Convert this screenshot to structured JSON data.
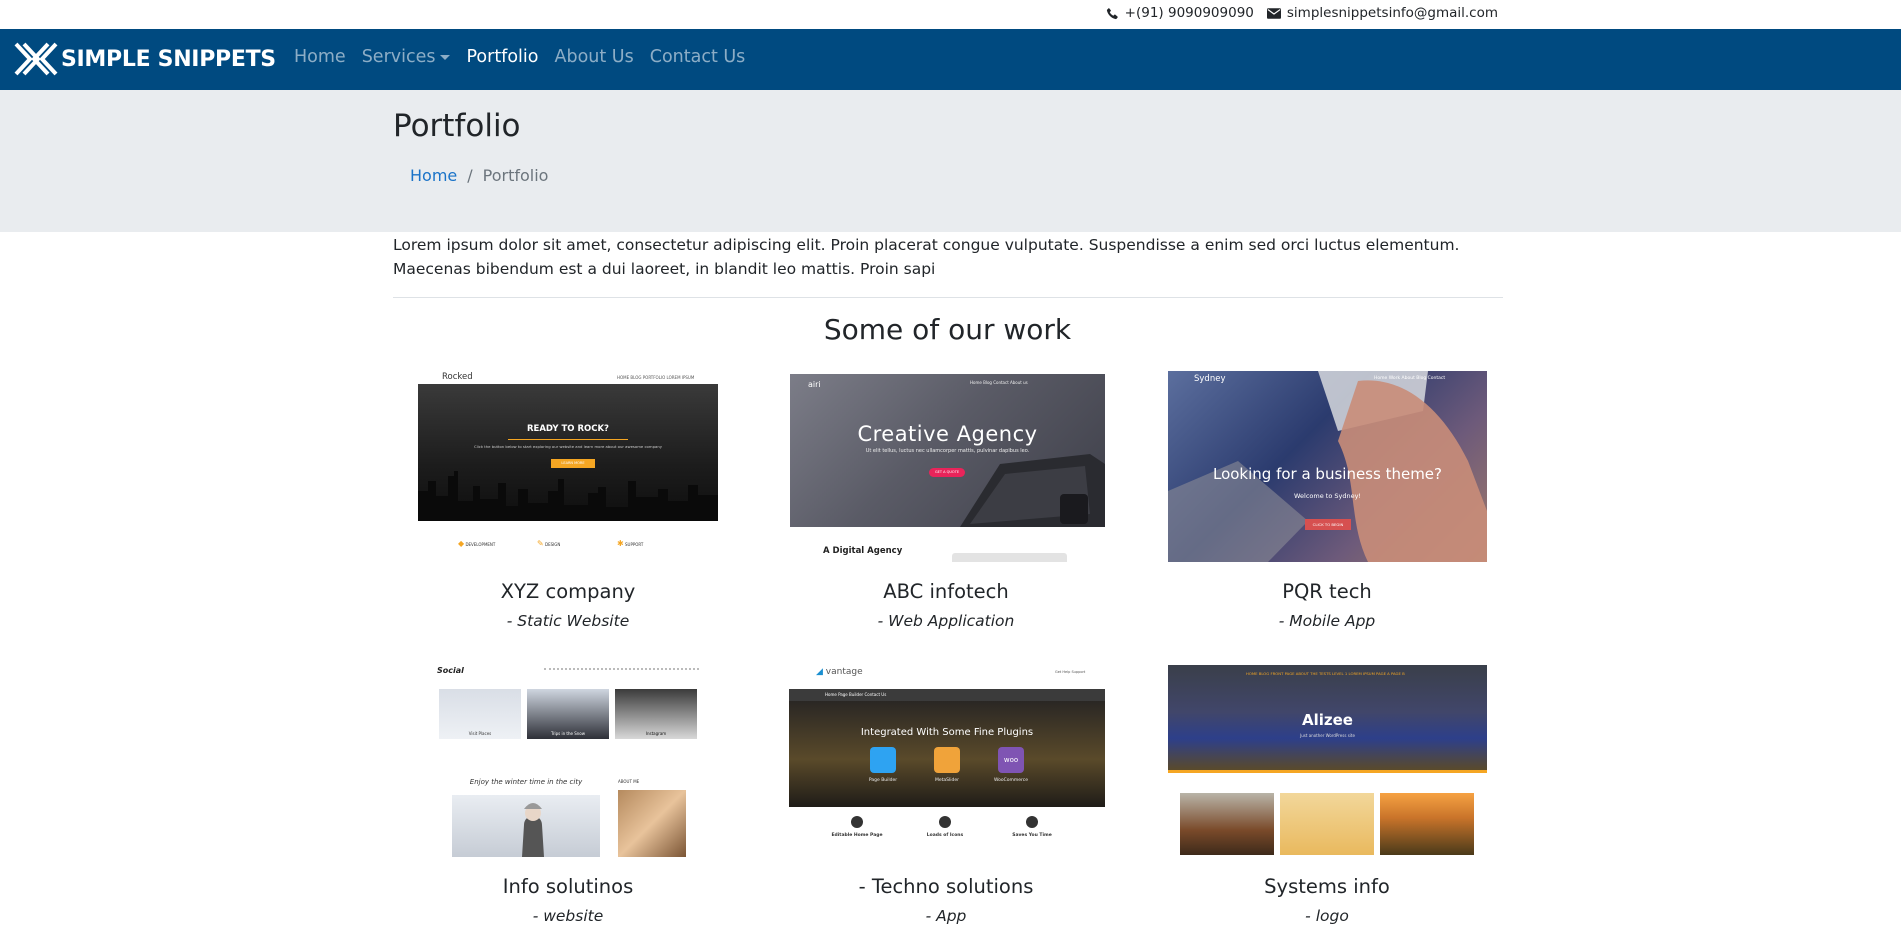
{
  "topbar": {
    "phone": "+(91) 9090909090",
    "email": "simplesnippetsinfo@gmail.com",
    "phone_icon": "phone-icon",
    "email_icon": "envelope-icon"
  },
  "navbar": {
    "brand": "SIMPLE SNIPPETS",
    "links": [
      {
        "label": "Home"
      },
      {
        "label": "Services"
      },
      {
        "label": "Portfolio"
      },
      {
        "label": "About Us"
      },
      {
        "label": "Contact Us"
      }
    ],
    "background": "#004a80"
  },
  "header": {
    "title": "Portfolio",
    "breadcrumb": {
      "home": "Home",
      "separator": "/",
      "current": "Portfolio"
    }
  },
  "intro": "Lorem ipsum dolor sit amet, consectetur adipiscing elit. Proin placerat congue vulputate. Suspendisse a enim sed orci luctus elementum. Maecenas bibendum est a dui laoreet, in blandit leo mattis. Proin sapi",
  "section_title": "Some of our work",
  "cards": [
    {
      "title": "XYZ company",
      "subtitle": "- Static Website",
      "thumb": {
        "logo": "Rocked",
        "nav": "HOME   BLOG   PORTFOLIO   LOREM IPSUM",
        "heading": "READY TO ROCK?",
        "text": "Click the button below to start exploring our website and learn more about our awesome company",
        "button": "LEARN MORE",
        "features": [
          "DEVELOPMENT",
          "DESIGN",
          "SUPPORT"
        ]
      }
    },
    {
      "title": "ABC infotech",
      "subtitle": "- Web Application",
      "thumb": {
        "logo": "airi",
        "nav": "Home   Blog   Contact   About us",
        "heading": "Creative Agency",
        "text": "Ut elit tellus, luctus nec ullamcorper mattis, pulvinar dapibus leo.",
        "button": "GET A QUOTE",
        "footer": "A Digital Agency"
      }
    },
    {
      "title": "PQR tech",
      "subtitle": "- Mobile App",
      "thumb": {
        "logo": "Sydney",
        "nav": "Home   Work   About   Blog   Contact",
        "heading": "Looking for a business theme?",
        "text": "Welcome to Sydney!",
        "button": "CLICK TO BEGIN"
      }
    },
    {
      "title": "Info solutinos",
      "subtitle": "- website",
      "thumb": {
        "logo": "Social",
        "captions": [
          "Visit Places",
          "Trips in the Snow",
          "Instagram"
        ],
        "post": "Enjoy the winter time in the city",
        "about": "ABOUT ME"
      }
    },
    {
      "title": "- Techno solutions",
      "subtitle": "- App",
      "thumb": {
        "logo": "vantage",
        "nav": "Home   Page Builder   Contact Us",
        "heading": "Integrated With Some Fine Plugins",
        "plugins": [
          "Page Builder",
          "MetaSlider",
          "WooCommerce"
        ],
        "features": [
          "Editable Home Page",
          "Loads of Icons",
          "Saves You Time"
        ],
        "support": "Get Help Support"
      }
    },
    {
      "title": "Systems info",
      "subtitle": "- logo",
      "thumb": {
        "heading": "Alizee",
        "text": "Just another WordPress site",
        "nav": "HOME   BLOG   FRONT PAGE   ABOUT THE TESTS   LEVEL 1   LOREM IPSUM   PAGE A   PAGE B"
      }
    }
  ]
}
